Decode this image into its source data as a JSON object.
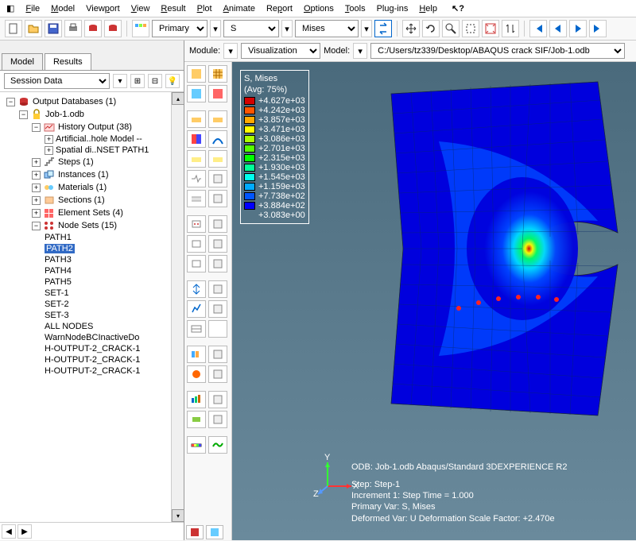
{
  "menubar": {
    "items": [
      "File",
      "Model",
      "Viewport",
      "View",
      "Result",
      "Plot",
      "Animate",
      "Report",
      "Options",
      "Tools",
      "Plug-ins",
      "Help"
    ]
  },
  "toolbar": {
    "selectors": {
      "primary": "Primary",
      "field": "S",
      "component": "Mises"
    }
  },
  "left_tabs": {
    "model": "Model",
    "results": "Results"
  },
  "session_label": "Session Data",
  "tree": {
    "root": "Output Databases (1)",
    "job": "Job-1.odb",
    "history": "History Output (38)",
    "history_children": [
      "Artificial..hole Model --",
      "Spatial di..NSET PATH1"
    ],
    "steps": "Steps (1)",
    "instances": "Instances (1)",
    "materials": "Materials (1)",
    "sections": "Sections (1)",
    "elemsets": "Element Sets (4)",
    "nodesets": "Node Sets (15)",
    "nodeset_items": [
      "PATH1",
      "PATH2",
      "PATH3",
      "PATH4",
      "PATH5",
      "SET-1",
      "SET-2",
      "SET-3",
      "ALL NODES",
      "WarnNodeBCInactiveDo",
      "H-OUTPUT-2_CRACK-1",
      "H-OUTPUT-2_CRACK-1",
      "H-OUTPUT-2_CRACK-1"
    ],
    "selected": "PATH2"
  },
  "context": {
    "module_label": "Module:",
    "module_value": "Visualization",
    "model_label": "Model:",
    "model_value": "C:/Users/tz339/Desktop/ABAQUS crack SIF/Job-1.odb"
  },
  "legend": {
    "title": "S, Mises",
    "avg": "(Avg: 75%)",
    "values": [
      "+4.627e+03",
      "+4.242e+03",
      "+3.857e+03",
      "+3.471e+03",
      "+3.086e+03",
      "+2.701e+03",
      "+2.315e+03",
      "+1.930e+03",
      "+1.545e+03",
      "+1.159e+03",
      "+7.738e+02",
      "+3.884e+02",
      "+3.083e+00"
    ],
    "colors": [
      "#d40000",
      "#ff5500",
      "#ffaa00",
      "#ffff00",
      "#aaff00",
      "#55ff00",
      "#00ff00",
      "#00ff99",
      "#00ffee",
      "#00aaff",
      "#0055ff",
      "#0000ff"
    ]
  },
  "info": {
    "odb": "ODB: Job-1.odb    Abaqus/Standard 3DEXPERIENCE R2",
    "step": "Step: Step-1",
    "incr": "Increment     1: Step Time =   1.000",
    "primary": "Primary Var: S, Mises",
    "deformed": "Deformed Var: U   Deformation Scale Factor: +2.470e"
  },
  "triad": {
    "x": "X",
    "y": "Y",
    "z": "Z"
  }
}
